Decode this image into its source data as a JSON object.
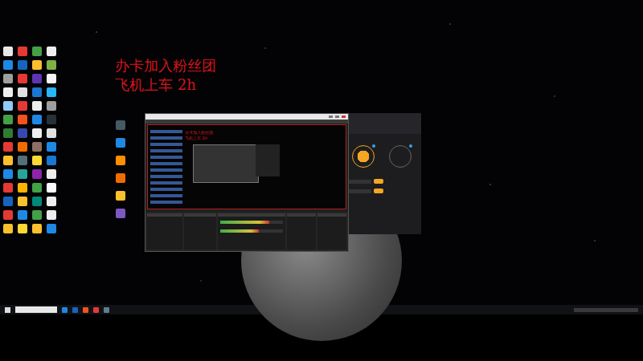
{
  "overlay_text": [
    "办卡加入粉丝团",
    "飞机上车 2h"
  ],
  "desktop_icons": {
    "left": [
      "#e8e8e8",
      "#e53935",
      "#43a047",
      "#eeeeee",
      "#1e88e5",
      "#1565c0",
      "#fbc02d",
      "#7cb342",
      "#9e9e9e",
      "#e53935",
      "#5e35b1",
      "#f5f5f5",
      "#eeeeee",
      "#e0e0e0",
      "#1976d2",
      "#29b6f6",
      "#90caf9",
      "#e53935",
      "#eeeeee",
      "#9e9e9e",
      "#43a047",
      "#f4511e",
      "#1e88e5",
      "#263238",
      "#2e7d32",
      "#3949ab",
      "#eeeeee",
      "#e0e0e0",
      "#e53935",
      "#ef6c00",
      "#8d6e63",
      "#1e88e5",
      "#fbc02d",
      "#546e7a",
      "#fdd835",
      "#1976d2",
      "#1e88e5",
      "#26a69a",
      "#8e24aa",
      "#eeeeee",
      "#e53935",
      "#ffb300",
      "#43a047",
      "#fafafa",
      "#1565c0",
      "#fbc02d",
      "#00897b",
      "#eeeeee",
      "#e53935",
      "#1e88e5",
      "#43a047",
      "#eeeeee",
      "#fbc02d",
      "#fdd835",
      "#fbc02d",
      "#1e88e5"
    ],
    "right": [
      "#455a64",
      "#1e88e5",
      "#ff8f00",
      "#ef6c00",
      "#fbc02d",
      "#7e57c2"
    ]
  },
  "obs_window": {
    "preview_text": [
      "办卡加入粉丝团",
      "飞机上车 2h"
    ],
    "mixer": [
      {
        "level": 0.78
      },
      {
        "level": 0.62
      }
    ]
  },
  "side_window": {
    "dials": [
      {
        "active": true
      },
      {
        "active": false
      }
    ],
    "buttons": [
      {
        "color": "#f5a623"
      },
      {
        "color": "#f5a623"
      }
    ]
  },
  "taskbar": {
    "apps": [
      "#1e88e5",
      "#1565c0",
      "#f4511e",
      "#e53935",
      "#607d8b"
    ]
  }
}
